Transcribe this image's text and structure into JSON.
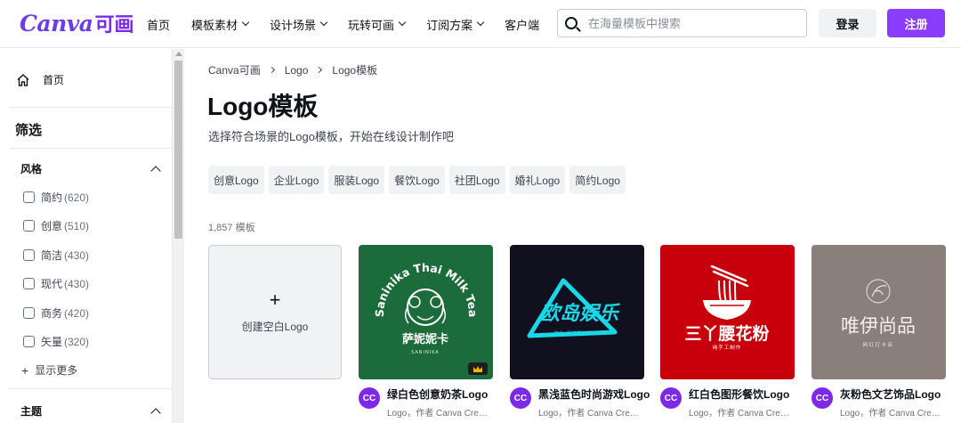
{
  "header": {
    "logo_text": "Canva",
    "logo_cn": "可画",
    "nav": [
      {
        "label": "首页",
        "dropdown": false
      },
      {
        "label": "模板素材",
        "dropdown": true
      },
      {
        "label": "设计场景",
        "dropdown": true
      },
      {
        "label": "玩转可画",
        "dropdown": true
      },
      {
        "label": "订阅方案",
        "dropdown": true
      },
      {
        "label": "客户端",
        "dropdown": false
      }
    ],
    "search_placeholder": "在海量模板中搜索",
    "login_label": "登录",
    "signup_label": "注册",
    "brand_color": "#8b3dff"
  },
  "sidebar": {
    "home_label": "首页",
    "filter_title": "筛选",
    "style_group": {
      "title": "风格",
      "items": [
        {
          "label": "简约",
          "count": "(620)"
        },
        {
          "label": "创意",
          "count": "(510)"
        },
        {
          "label": "简洁",
          "count": "(430)"
        },
        {
          "label": "现代",
          "count": "(430)"
        },
        {
          "label": "商务",
          "count": "(420)"
        },
        {
          "label": "矢量",
          "count": "(320)"
        }
      ],
      "show_more": "显示更多"
    },
    "topic_group": {
      "title": "主题"
    }
  },
  "main": {
    "breadcrumb": [
      "Canva可画",
      "Logo",
      "Logo模板"
    ],
    "title": "Logo模板",
    "subtitle": "选择符合场景的Logo模板，开始在线设计制作吧",
    "chips": [
      "创意Logo",
      "企业Logo",
      "服装Logo",
      "餐饮Logo",
      "社团Logo",
      "婚礼Logo",
      "简约Logo"
    ],
    "result_count": "1,857 模板",
    "create_label": "创建空白Logo",
    "templates": [
      {
        "name": "绿白色创意奶茶Logo",
        "meta": "Logo，作者 Canva Crea...",
        "avatar": "CC",
        "bg": "#1c6b3a",
        "art_lines": [
          "Saninika Thai Milk Tea",
          "萨妮妮卡",
          "SANINIKA"
        ],
        "premium": true
      },
      {
        "name": "黑浅蓝色时尚游戏Logo",
        "meta": "Logo，作者 Canva Crea...",
        "avatar": "CC",
        "bg": "#11101e",
        "art_lines": [
          "欧岛娱乐",
          "游戏一起 嗨翻一夏"
        ],
        "premium": false
      },
      {
        "name": "红白色图形餐饮Logo",
        "meta": "Logo，作者 Canva Crea...",
        "avatar": "CC",
        "bg": "#c8000b",
        "art_lines": [
          "三丫腰花粉",
          "纯手工制作"
        ],
        "premium": false
      },
      {
        "name": "灰粉色文艺饰品Logo",
        "meta": "Logo，作者 Canva Crea...",
        "avatar": "CC",
        "bg": "#8a7f7a",
        "art_lines": [
          "唯伊尚品",
          "网红打卡店"
        ],
        "premium": false
      }
    ]
  }
}
